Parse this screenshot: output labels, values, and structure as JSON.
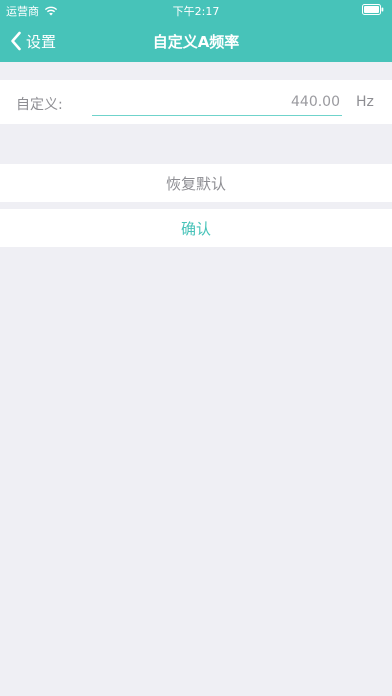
{
  "status_bar": {
    "carrier": "运营商",
    "time": "下午2:17"
  },
  "nav": {
    "back_label": "设置",
    "title": "自定义A频率"
  },
  "form": {
    "label": "自定义:",
    "value": "440.00",
    "unit": "Hz"
  },
  "actions": {
    "reset_label": "恢复默认",
    "confirm_label": "确认"
  },
  "colors": {
    "nav_background": "#47c3b9",
    "page_background": "#efeff4",
    "accent": "#47c3b9",
    "input_underline": "#6fd3cb"
  },
  "icons": {
    "wifi": "wifi-icon",
    "battery": "battery-icon",
    "back": "chevron-left-icon"
  }
}
